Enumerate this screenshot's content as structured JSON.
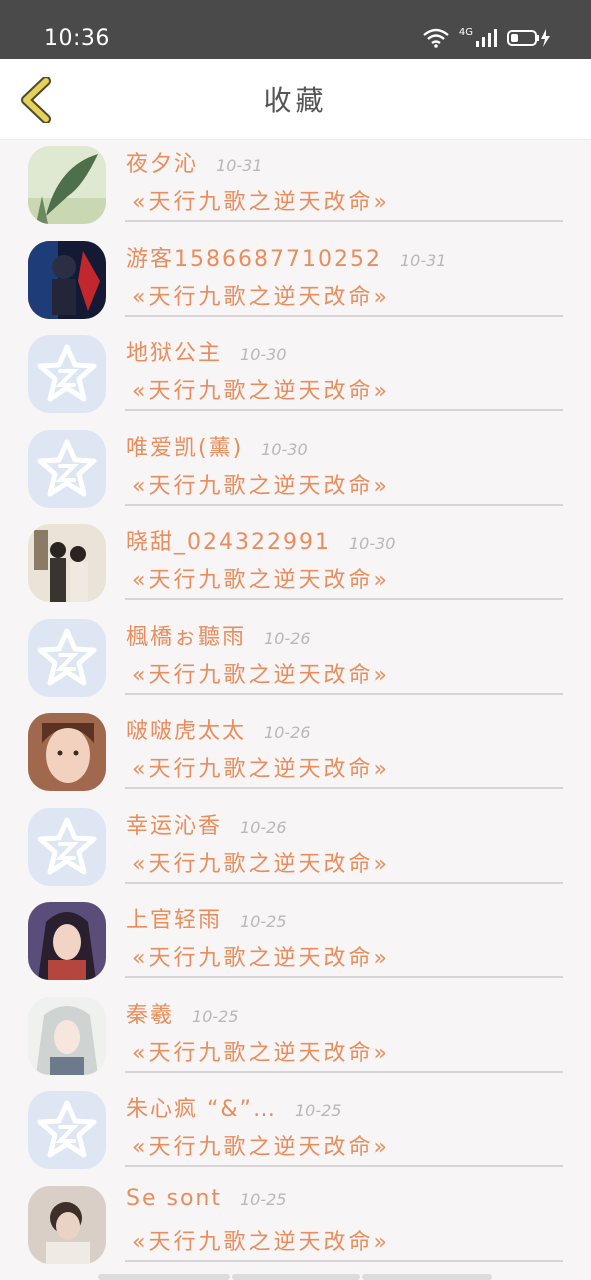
{
  "status_bar": {
    "time": "10:36",
    "network": "4G"
  },
  "header": {
    "title": "收藏"
  },
  "items": [
    {
      "name": "夜夕沁",
      "date": "10-31",
      "book": "«天行九歌之逆天改命»",
      "avatar": "landscape-photo"
    },
    {
      "name": "游客15866877102​52",
      "date": "10-31",
      "book": "«天行九歌之逆天改命»",
      "avatar": "game-character"
    },
    {
      "name": "地狱公主",
      "date": "10-30",
      "book": "«天行九歌之逆天改命»",
      "avatar": "default-star"
    },
    {
      "name": "唯爱凯(薰)",
      "date": "10-30",
      "book": "«天行九歌之逆天改命»",
      "avatar": "default-star"
    },
    {
      "name": "晓甜_024322991",
      "date": "10-30",
      "book": "«天行九歌之逆天改命»",
      "avatar": "couple-photo"
    },
    {
      "name": "楓橋ぉ聽雨",
      "date": "10-26",
      "book": "«天行九歌之逆天改命»",
      "avatar": "default-star"
    },
    {
      "name": "啵啵虎太太",
      "date": "10-26",
      "book": "«天行九歌之逆天改命»",
      "avatar": "girl-portrait"
    },
    {
      "name": "幸运沁香",
      "date": "10-26",
      "book": "«天行九歌之逆天改命»",
      "avatar": "default-star"
    },
    {
      "name": "上官轻雨",
      "date": "10-25",
      "book": "«天行九歌之逆天改命»",
      "avatar": "anime-girl"
    },
    {
      "name": "秦羲",
      "date": "10-25",
      "book": "«天行九歌之逆天改命»",
      "avatar": "anime-white-hair"
    },
    {
      "name": "朱心疯 “&”…",
      "date": "10-25",
      "book": "«天行九歌之逆天改命»",
      "avatar": "default-star"
    },
    {
      "name": "Se sont",
      "date": "10-25",
      "book": "«天行九歌之逆天改命»",
      "avatar": "person-photo"
    }
  ],
  "colors": {
    "accent": "#e98d5c",
    "back_arrow": "#e6d25a",
    "default_avatar": "#dde6f2"
  }
}
